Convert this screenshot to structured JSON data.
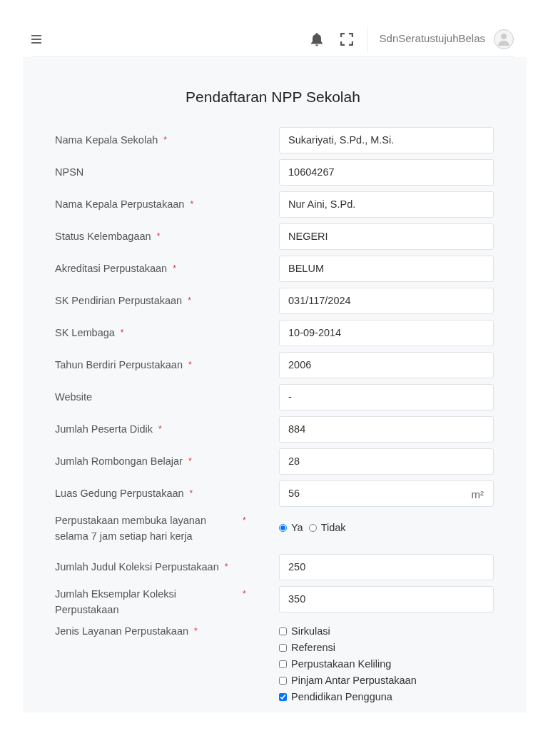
{
  "header": {
    "user": "SdnSeratustujuhBelas"
  },
  "form": {
    "title": "Pendaftaran NPP Sekolah",
    "fields": [
      {
        "kind": "text",
        "label": "Nama Kepala Sekolah",
        "required": "*",
        "value": "Sukariyati, S.Pd., M.Si."
      },
      {
        "kind": "text",
        "label": "NPSN",
        "value": "10604267"
      },
      {
        "kind": "text",
        "label": "Nama Kepala Perpustakaan",
        "required": "*",
        "value": "Nur Aini, S.Pd."
      },
      {
        "kind": "text",
        "label": "Status Kelembagaan",
        "required": "*",
        "value": "NEGERI"
      },
      {
        "kind": "text",
        "label": "Akreditasi Perpustakaan",
        "required": "*",
        "value": "BELUM"
      },
      {
        "kind": "text",
        "label": "SK Pendirian Perpustakaan",
        "required": "*",
        "value": "031/117/2024"
      },
      {
        "kind": "text",
        "label": "SK Lembaga",
        "required": "*",
        "value": "10-09-2014"
      },
      {
        "kind": "text",
        "label": "Tahun Berdiri Perpustakaan",
        "required": "*",
        "value": "2006"
      },
      {
        "kind": "text",
        "label": "Website",
        "value": "-"
      },
      {
        "kind": "text",
        "label": "Jumlah Peserta Didik",
        "required": "*",
        "value": "884"
      },
      {
        "kind": "text",
        "label": "Jumlah Rombongan Belajar",
        "required": "*",
        "value": "28"
      },
      {
        "kind": "unit",
        "label": "Luas Gedung Perpustakaan",
        "required": "*",
        "value": "56",
        "unit": "m²"
      },
      {
        "kind": "radio",
        "label": "Perpustakaan membuka layanan selama 7 jam setiap hari kerja",
        "required": "*",
        "options": [
          {
            "label": "Ya",
            "selected": true
          },
          {
            "label": "Tidak",
            "selected": false
          }
        ]
      },
      {
        "kind": "text",
        "label": "Jumlah Judul Koleksi Perpustakaan",
        "required": "*",
        "value": "250"
      },
      {
        "kind": "text",
        "label": "Jumlah Eksemplar Koleksi Perpustakaan",
        "required": "*",
        "value": "350"
      },
      {
        "kind": "checkbox",
        "label": "Jenis Layanan Perpustakaan",
        "required": "*",
        "options": [
          {
            "label": "Sirkulasi",
            "checked": false
          },
          {
            "label": "Referensi",
            "checked": false
          },
          {
            "label": "Perpustakaan Keliling",
            "checked": false
          },
          {
            "label": "Pinjam Antar Perpustakaan",
            "checked": false
          },
          {
            "label": "Pendidikan Pengguna",
            "checked": true
          }
        ]
      }
    ]
  }
}
